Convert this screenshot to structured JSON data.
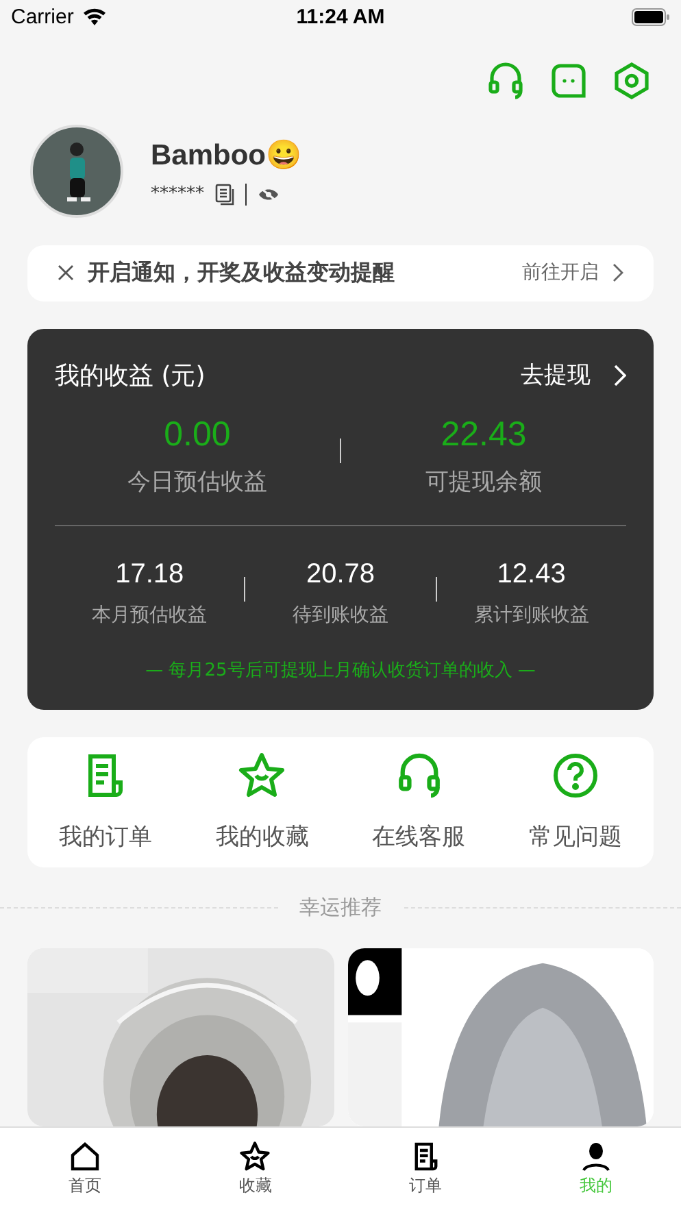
{
  "status_bar": {
    "carrier": "Carrier",
    "time": "11:24 AM"
  },
  "profile": {
    "name": "Bamboo😀",
    "account": "******",
    "hidden": true
  },
  "notice": {
    "text": "开启通知，开奖及收益变动提醒",
    "action": "前往开启"
  },
  "earnings": {
    "title": "我的收益 (元)",
    "action": "去提现",
    "main": [
      {
        "value": "0.00",
        "label": "今日预估收益"
      },
      {
        "value": "22.43",
        "label": "可提现余额"
      }
    ],
    "stats": [
      {
        "value": "17.18",
        "label": "本月预估收益"
      },
      {
        "value": "20.78",
        "label": "待到账收益"
      },
      {
        "value": "12.43",
        "label": "累计到账收益"
      }
    ],
    "note": "— 每月25号后可提现上月确认收货订单的收入 —"
  },
  "shortcuts": [
    {
      "kind": "orders",
      "label": "我的订单"
    },
    {
      "kind": "favorites",
      "label": "我的收藏"
    },
    {
      "kind": "service",
      "label": "在线客服"
    },
    {
      "kind": "faq",
      "label": "常见问题"
    }
  ],
  "recommend": {
    "title": "幸运推荐"
  },
  "tab_bar": [
    {
      "kind": "home",
      "label": "首页",
      "selected": false
    },
    {
      "kind": "favorites",
      "label": "收藏",
      "selected": false
    },
    {
      "kind": "orders",
      "label": "订单",
      "selected": false
    },
    {
      "kind": "me",
      "label": "我的",
      "selected": true
    }
  ]
}
